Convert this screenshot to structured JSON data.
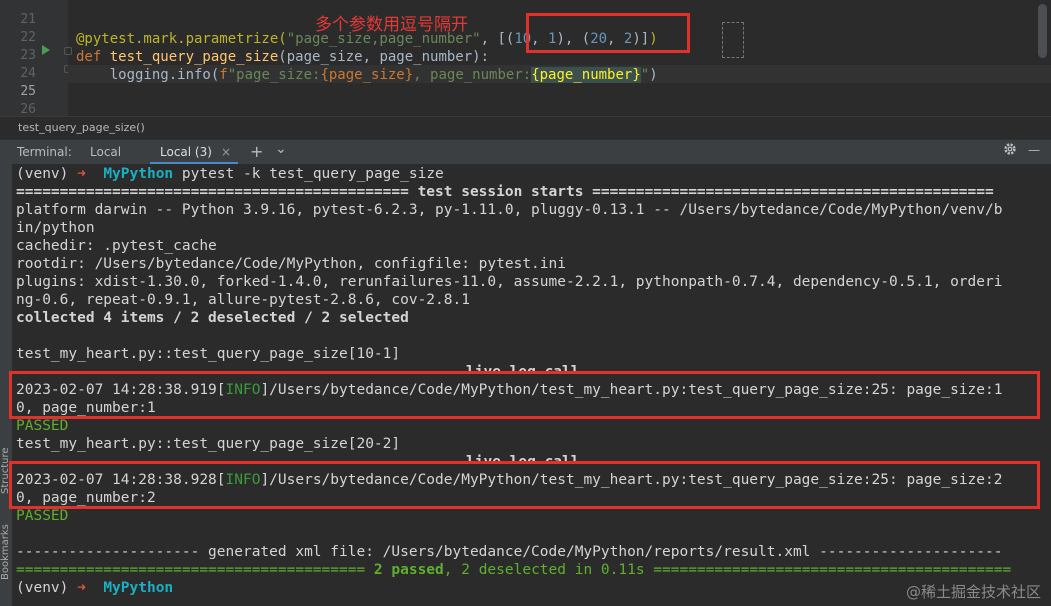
{
  "editor": {
    "line_numbers": [
      "21",
      "22",
      "23",
      "24",
      "25",
      "26"
    ],
    "annotation": "多个参数用逗号隔开",
    "line23": {
      "decorator": "@pytest.mark.parametrize(",
      "arg_string": "\"page_size,page_number\"",
      "comma": ", ",
      "values_open": "[(",
      "v1": "10",
      "c1": ", ",
      "v2": "1",
      "mid": "), (",
      "v3": "20",
      "c2": ", ",
      "v4": "2",
      "values_close": ")]",
      "paren_close": ")"
    },
    "line24": {
      "keyword": "def ",
      "function": "test_query_page_size",
      "params": "(page_size, page_number):"
    },
    "line25": {
      "indent": "    ",
      "call": "logging.info(",
      "fprefix": "f",
      "s1": "\"page_size:",
      "b1": "{page_size}",
      "s2": ", page_number:",
      "b2": "{page_number}",
      "s3": "\"",
      "close": ")"
    }
  },
  "breadcrumb": "test_query_page_size()",
  "terminal_tabs": {
    "label": "Terminal:",
    "tabs": [
      "Local",
      "Local (3)"
    ],
    "active_tab_index": 1,
    "close_glyph": "×",
    "add_glyph": "+",
    "dropdown_glyph": "⌄",
    "settings_icon": "gear-icon",
    "minimize_glyph": "—"
  },
  "side_labels": [
    "Structure",
    "Bookmarks"
  ],
  "terminal": {
    "prompt_venv": "(venv) ",
    "prompt_arrow": "➜  ",
    "prompt_dir": "MyPython",
    "command": " pytest -k test_query_page_size",
    "session_start": "============================================= test session starts ==============================================",
    "platform_1": "platform darwin -- Python 3.9.16, pytest-6.2.3, py-1.11.0, pluggy-0.13.1 -- /Users/bytedance/Code/MyPython/venv/b",
    "platform_2": "in/python",
    "cachedir": "cachedir: .pytest_cache",
    "rootdir": "rootdir: /Users/bytedance/Code/MyPython, configfile: pytest.ini",
    "plugins_1": "plugins: xdist-1.30.0, forked-1.4.0, rerunfailures-11.0, assume-2.2.1, pythonpath-0.7.4, dependency-0.5.1, orderi",
    "plugins_2": "ng-0.6, repeat-0.9.1, allure-pytest-2.8.6, cov-2.8.1",
    "collected": "collected 4 items / 2 deselected / 2 selected",
    "test1": "test_my_heart.py::test_query_page_size[10-1]",
    "live_log_1": "live log call",
    "log1_ts": "2023-02-07 14:28:38.919[",
    "log1_level": "INFO",
    "log1_msg": "]/Users/bytedance/Code/MyPython/test_my_heart.py:test_query_page_size:25: page_size:1",
    "log1_cont": "0, page_number:1",
    "passed1": "PASSED",
    "test2": "test_my_heart.py::test_query_page_size[20-2]",
    "live_log_2": "live log call",
    "log2_ts": "2023-02-07 14:28:38.928[",
    "log2_level": "INFO",
    "log2_msg": "]/Users/bytedance/Code/MyPython/test_my_heart.py:test_query_page_size:25: page_size:2",
    "log2_cont": "0, page_number:2",
    "passed2": "PASSED",
    "xml_line": "--------------------- generated xml file: /Users/bytedance/Code/MyPython/reports/result.xml ---------------------",
    "summary_left": "======================================== ",
    "summary_passed": "2 passed",
    "summary_mid": ", ",
    "summary_deselected": "2 deselected in 0.11s",
    "summary_right": " =========================================",
    "final_prompt_venv": "(venv) ",
    "final_prompt_arrow": "➜  ",
    "final_prompt_dir": "MyPython"
  },
  "watermark": "@稀土掘金技术社区",
  "colors": {
    "background": "#2b2b2b",
    "annotation_red": "#e0312b",
    "accent_blue": "#4a88c7",
    "pass_green": "#5faf2e",
    "prompt_cyan": "#1ab0c3"
  }
}
